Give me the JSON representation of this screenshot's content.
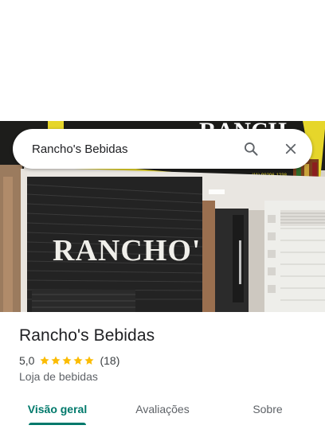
{
  "search": {
    "query": "Rancho's Bebidas",
    "search_icon": "search-icon",
    "close_icon": "close-icon"
  },
  "photo": {
    "sign_text": "RANCHO'S",
    "banner_text": "RANCH",
    "phone_text": "(11) 98206-1238"
  },
  "place": {
    "name": "Rancho's Bebidas",
    "rating": "5,0",
    "rating_stars": 5,
    "review_count": "(18)",
    "category": "Loja de bebidas"
  },
  "tabs": [
    {
      "label": "Visão geral",
      "active": true
    },
    {
      "label": "Avaliações",
      "active": false
    },
    {
      "label": "Sobre",
      "active": false
    }
  ],
  "colors": {
    "accent": "#00796b",
    "star": "#fbbc04",
    "banner_yellow": "#e6d62a"
  }
}
